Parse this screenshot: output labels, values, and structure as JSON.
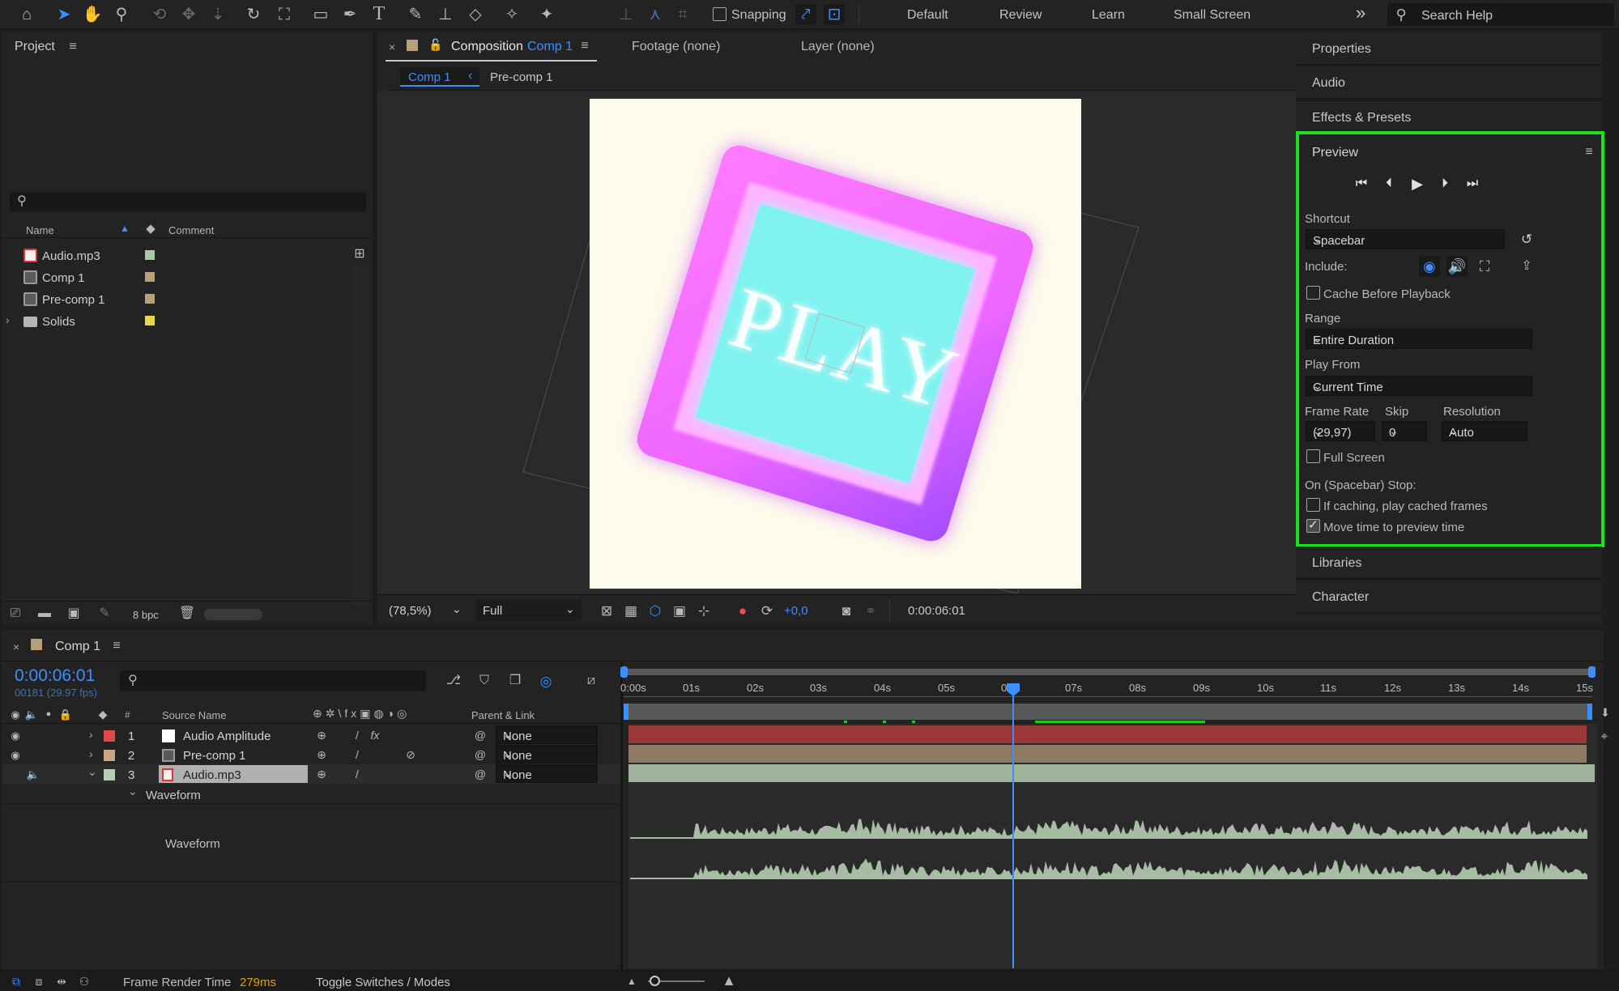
{
  "toolbar": {
    "snapping_label": "Snapping",
    "workspaces": [
      "Default",
      "Review",
      "Learn",
      "Small Screen"
    ],
    "search_placeholder": "Search Help",
    "more_glyph": "»"
  },
  "project": {
    "title": "Project",
    "search_placeholder": "",
    "columns": {
      "name": "Name",
      "comment": "Comment"
    },
    "items": [
      {
        "name": "Audio.mp3",
        "type": "audio",
        "label_color": "#a9c8a6"
      },
      {
        "name": "Comp 1",
        "type": "comp",
        "label_color": "#b8a07a"
      },
      {
        "name": "Pre-comp 1",
        "type": "comp",
        "label_color": "#b8a07a"
      },
      {
        "name": "Solids",
        "type": "folder",
        "label_color": "#e6d84a"
      }
    ],
    "bpc_label": "8 bpc"
  },
  "composition": {
    "tab_label": "Composition",
    "tab_comp_name": "Comp 1",
    "footage_tab": "Footage (none)",
    "layer_tab": "Layer (none)",
    "breadcrumbs": [
      "Comp 1",
      "Pre-comp 1"
    ],
    "canvas_text": "PLAY",
    "zoom": "(78,5%)",
    "resolution": "Full",
    "exposure": "+0,0",
    "timecode": "0:00:06:01"
  },
  "right_panels": {
    "top": [
      "Properties",
      "Audio",
      "Effects & Presets"
    ],
    "bottom": [
      "Libraries",
      "Character"
    ]
  },
  "preview": {
    "title": "Preview",
    "shortcut_label": "Shortcut",
    "shortcut_value": "Spacebar",
    "include_label": "Include:",
    "cache_label": "Cache Before Playback",
    "range_label": "Range",
    "range_value": "Entire Duration",
    "play_from_label": "Play From",
    "play_from_value": "Current Time",
    "frame_rate_label": "Frame Rate",
    "skip_label": "Skip",
    "resolution_label": "Resolution",
    "frame_rate_value": "(29,97)",
    "skip_value": "0",
    "resolution_value": "Auto",
    "full_screen_label": "Full Screen",
    "stop_label": "On (Spacebar) Stop:",
    "if_caching_label": "If caching, play cached frames",
    "move_time_label": "Move time to preview time",
    "checks": {
      "cache": false,
      "full_screen": false,
      "if_caching": false,
      "move_time": true
    }
  },
  "timeline": {
    "tab_label": "Comp 1",
    "timecode": "0:00:06:01",
    "frame_info": "00181 (29.97 fps)",
    "columns": {
      "num": "#",
      "source": "Source Name",
      "parent": "Parent & Link"
    },
    "layers": [
      {
        "num": "1",
        "name": "Audio Amplitude",
        "label_color": "#e04a4a",
        "parent": "None"
      },
      {
        "num": "2",
        "name": "Pre-comp 1",
        "label_color": "#c8a882",
        "parent": "None"
      },
      {
        "num": "3",
        "name": "Audio.mp3",
        "label_color": "#b9cdb5",
        "parent": "None"
      }
    ],
    "waveform_group": "Waveform",
    "waveform_label": "Waveform",
    "ticks": [
      "0:00s",
      "01s",
      "02s",
      "03s",
      "04s",
      "05s",
      "06s",
      "07s",
      "08s",
      "09s",
      "10s",
      "11s",
      "12s",
      "13s",
      "14s",
      "15s"
    ]
  },
  "status": {
    "frame_render_label": "Frame Render Time",
    "frame_render_value": "279ms",
    "toggle_label": "Toggle Switches / Modes"
  }
}
